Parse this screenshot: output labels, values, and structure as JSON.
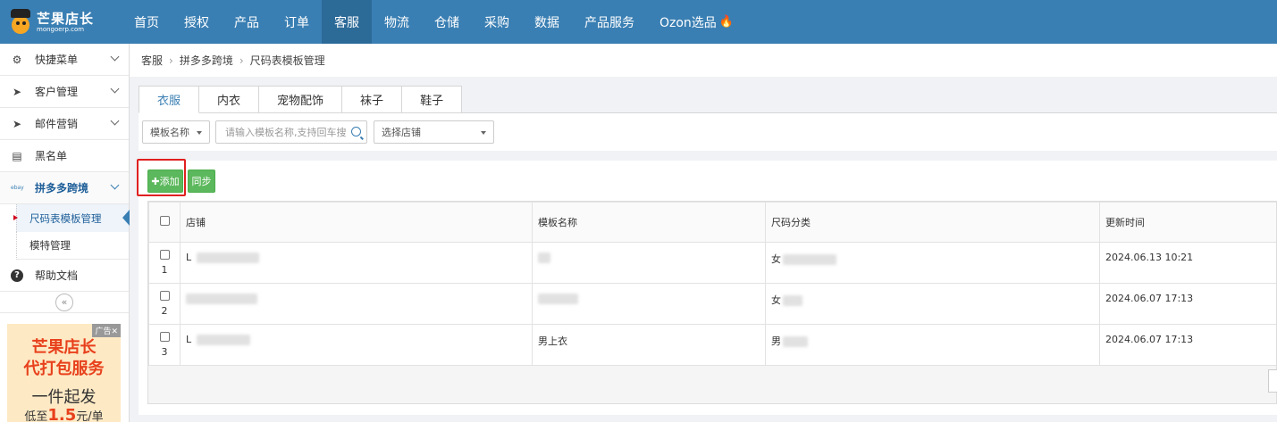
{
  "app": {
    "logo_cn": "芒果店长",
    "logo_en": "mongoerp.com"
  },
  "nav": {
    "items": [
      "首页",
      "授权",
      "产品",
      "订单",
      "客服",
      "物流",
      "仓储",
      "采购",
      "数据",
      "产品服务",
      "Ozon选品"
    ],
    "active": "客服"
  },
  "sidebar": {
    "items": [
      {
        "label": "快捷菜单",
        "icon": "gear-icon"
      },
      {
        "label": "客户管理",
        "icon": "paper-plane-icon"
      },
      {
        "label": "邮件营销",
        "icon": "paper-plane-icon"
      },
      {
        "label": "黑名单",
        "icon": "edit-list-icon"
      },
      {
        "label": "拼多多跨境",
        "icon": "ebay-icon",
        "icon_text": "ebay"
      }
    ],
    "sub_items": [
      "尺码表模板管理",
      "模特管理"
    ],
    "help": "帮助文档",
    "collapse": "«"
  },
  "ad": {
    "tag": "广告✕",
    "line1": "芒果店长",
    "line2": "代打包服务",
    "line3": "一件起发",
    "line4_a": "低至",
    "line4_b": "1.5",
    "line4_c": "元/单"
  },
  "breadcrumb": [
    "客服",
    "拼多多跨境",
    "尺码表模板管理"
  ],
  "tabs": [
    "衣服",
    "内衣",
    "宠物配饰",
    "袜子",
    "鞋子"
  ],
  "active_tab": "衣服",
  "filters": {
    "field_select": "模板名称",
    "search_placeholder": "请输入模板名称,支持回车搜",
    "shop_select": "选择店铺"
  },
  "toolbar": {
    "add_label": "✚添加",
    "sync_label": "同步"
  },
  "table": {
    "columns": [
      "店铺",
      "模板名称",
      "尺码分类",
      "更新时间"
    ],
    "rows": [
      {
        "num": "1",
        "shop": "L",
        "template": "",
        "category": "女",
        "updated": "2024.06.13 10:21"
      },
      {
        "num": "2",
        "shop": "",
        "template": "",
        "category": "女",
        "updated": "2024.06.07 17:13"
      },
      {
        "num": "3",
        "shop": "L",
        "template": "男上衣",
        "category": "男",
        "updated": "2024.06.07 17:13"
      }
    ]
  },
  "colors": {
    "topbar": "#3a7fb3",
    "active_nav": "#2c6a98",
    "button_green": "#5cb85c",
    "highlight_red": "#e02020"
  }
}
